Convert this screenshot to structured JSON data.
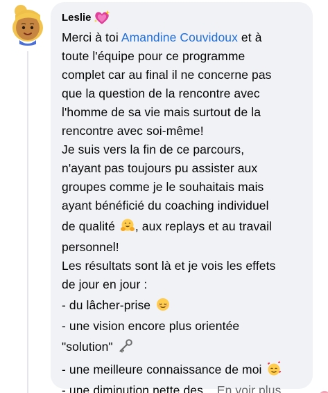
{
  "comment": {
    "author": "Leslie",
    "author_badge_icon": "sparkling-heart-icon",
    "mention": "Amandine Couvidoux",
    "lines": [
      {
        "before": "Merci à toi ",
        "after": " et à"
      },
      "toute l'équipe pour ce programme",
      "complet car au final il ne concerne pas",
      "que la question de la rencontre avec",
      "l'homme de sa vie mais surtout de la",
      "rencontre avec soi-même!",
      "Je suis vers la fin de ce parcours,",
      "n'ayant pas toujours pu assister aux",
      "groupes comme je le souhaitais mais",
      "ayant bénéficié du coaching individuel"
    ],
    "quality_before": "de qualité ",
    "quality_after": ", aux replays et au travail",
    "line_personnel": "personnel!",
    "line_resultats": "Les résultats sont là et je vois les effets",
    "line_jour": "de jour en jour :",
    "bullet_1": "- du lâcher-prise ",
    "bullet_2": "- une vision encore plus orientée",
    "bullet_3": "\"solution\" ",
    "bullet_4": "- une meilleure connaissance de moi ",
    "bullet_5": "- une diminution nette des...",
    "see_more": "En voir plus"
  },
  "icons": {
    "hugging": "hugging-face-icon",
    "relieved": "relieved-face-icon",
    "key": "old-key-icon",
    "smiling_hearts": "smiling-face-with-hearts-icon"
  },
  "colors": {
    "bubble": "#f0f2f5",
    "mention": "#216fdb",
    "see_more": "#65676b",
    "text": "#050505"
  }
}
